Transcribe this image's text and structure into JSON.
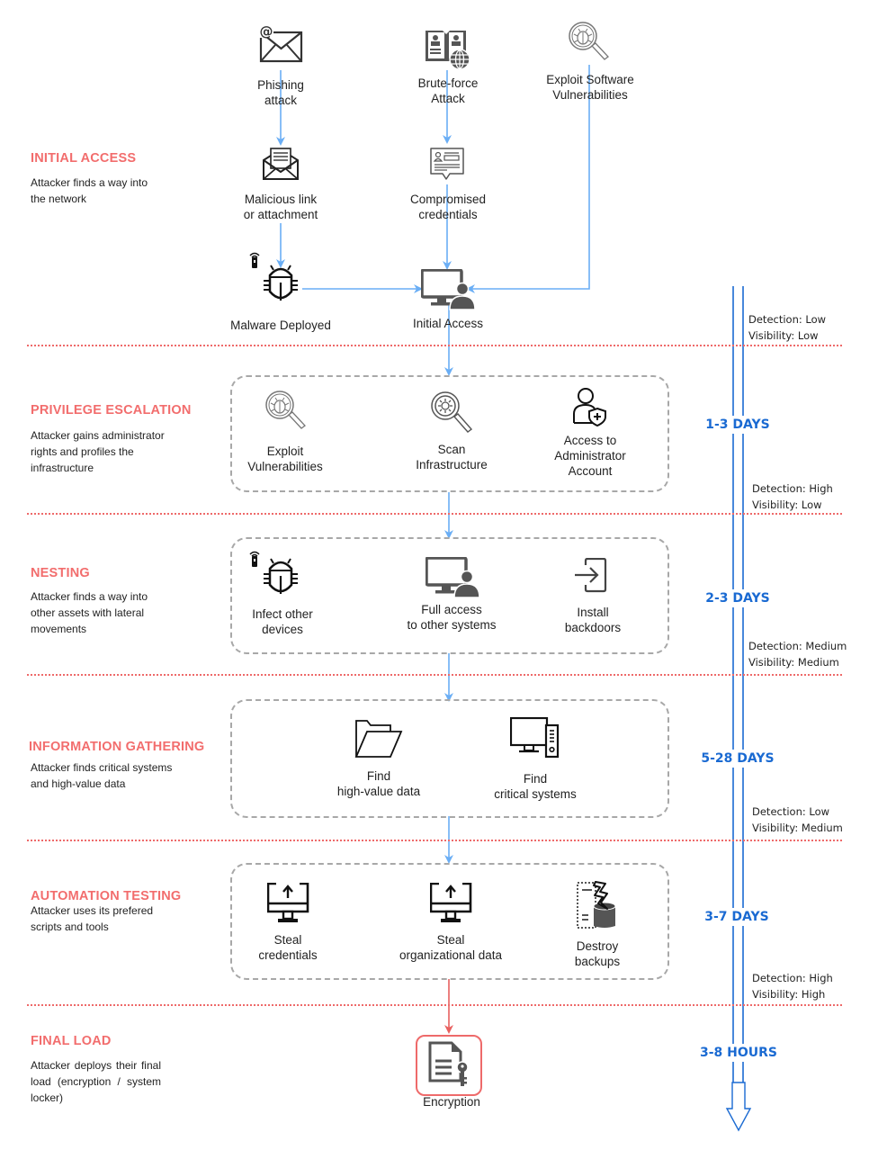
{
  "phases": [
    {
      "title": "INITIAL ACCESS",
      "description": "Attacker finds a way into the network",
      "nodes": [
        {
          "label": "Phishing attack",
          "icon": "email-at-icon"
        },
        {
          "label": "Brute-force Attack",
          "icon": "address-book-globe-icon"
        },
        {
          "label": "Exploit Software Vulnerabilities",
          "icon": "bug-magnifier-icon"
        },
        {
          "label": "Malicious link or attachment",
          "icon": "open-envelope-letter-icon"
        },
        {
          "label": "Compromised credentials",
          "icon": "id-card-bubble-icon"
        },
        {
          "label": "Malware Deployed",
          "icon": "bug-remote-icon"
        },
        {
          "label": "Initial Access",
          "icon": "computer-user-icon"
        }
      ],
      "duration": "",
      "detection": "Low",
      "visibility": "Low"
    },
    {
      "title": "PRIVILEGE ESCALATION",
      "description": "Attacker gains administrator rights and profiles the infrastructure",
      "nodes": [
        {
          "label": "Exploit Vulnerabilities",
          "icon": "bug-magnifier-icon"
        },
        {
          "label": "Scan Infrastructure",
          "icon": "virus-magnifier-icon"
        },
        {
          "label": "Access to Administrator Account",
          "icon": "user-shield-icon"
        }
      ],
      "duration": "1-3 DAYS",
      "detection": "High",
      "visibility": "Low"
    },
    {
      "title": "NESTING",
      "description": "Attacker finds a way into other assets with lateral movements",
      "nodes": [
        {
          "label": "Infect other devices",
          "icon": "bug-remote-icon"
        },
        {
          "label": "Full access to other systems",
          "icon": "computer-user-icon"
        },
        {
          "label": "Install backdoors",
          "icon": "sign-in-icon"
        }
      ],
      "duration": "2-3 DAYS",
      "detection": "Medium",
      "visibility": "Medium"
    },
    {
      "title": "INFORMATION GATHERING",
      "description": "Attacker finds critical systems and high-value data",
      "nodes": [
        {
          "label": "Find high-value data",
          "icon": "folder-open-icon"
        },
        {
          "label": "Find critical systems",
          "icon": "desktop-tower-icon"
        }
      ],
      "duration": "5-28 DAYS",
      "detection": "Low",
      "visibility": "Medium"
    },
    {
      "title": "AUTOMATION TESTING",
      "description": "Attacker uses its prefered scripts and tools",
      "nodes": [
        {
          "label": "Steal credentials",
          "icon": "monitor-upload-icon"
        },
        {
          "label": "Steal organizational data",
          "icon": "monitor-upload-icon"
        },
        {
          "label": "Destroy backups",
          "icon": "database-lightning-icon"
        }
      ],
      "duration": "3-7 DAYS",
      "detection": "High",
      "visibility": "High"
    },
    {
      "title": "FINAL LOAD",
      "description": "Attacker deploys their final load (encryption / system locker)",
      "nodes": [
        {
          "label": "Encryption",
          "icon": "document-key-icon"
        }
      ],
      "duration": "3-8 HOURS"
    }
  ],
  "labels": {
    "detection_prefix": "Detection: ",
    "visibility_prefix": "Visibility: "
  },
  "text": {
    "p0_node0_l1": "Phishing",
    "p0_node0_l2": "attack",
    "p0_node1_l1": "Brute-force",
    "p0_node1_l2": "Attack",
    "p0_node2_l1": "Exploit Software",
    "p0_node2_l2": "Vulnerabilities",
    "p0_node3_l1": "Malicious link",
    "p0_node3_l2": "or attachment",
    "p0_node4_l1": "Compromised",
    "p0_node4_l2": "credentials",
    "p0_node5_l1": "Malware Deployed",
    "p0_node6_l1": "Initial Access",
    "p0_desc_l1": "Attacker finds a way into",
    "p0_desc_l2": "the network",
    "p1_node0_l1": "Exploit",
    "p1_node0_l2": "Vulnerabilities",
    "p1_node1_l1": "Scan",
    "p1_node1_l2": "Infrastructure",
    "p1_node2_l1": "Access to",
    "p1_node2_l2": "Administrator",
    "p1_node2_l3": "Account",
    "p1_desc_l1": "Attacker gains administrator",
    "p1_desc_l2": "rights and profiles the",
    "p1_desc_l3": "infrastructure",
    "p2_node0_l1": "Infect other",
    "p2_node0_l2": "devices",
    "p2_node1_l1": "Full access",
    "p2_node1_l2": "to other systems",
    "p2_node2_l1": "Install",
    "p2_node2_l2": "backdoors",
    "p2_desc_l1": "Attacker finds a way into",
    "p2_desc_l2": "other assets with lateral",
    "p2_desc_l3": "movements",
    "p3_node0_l1": "Find",
    "p3_node0_l2": "high-value data",
    "p3_node1_l1": "Find",
    "p3_node1_l2": "critical systems",
    "p3_desc_l1": "Attacker finds critical systems",
    "p3_desc_l2": "and high-value data",
    "p4_node0_l1": "Steal",
    "p4_node0_l2": "credentials",
    "p4_node1_l1": "Steal",
    "p4_node1_l2": "organizational data",
    "p4_node2_l1": "Destroy",
    "p4_node2_l2": "backups",
    "p4_desc_l1": "Attacker uses its prefered",
    "p4_desc_l2": "scripts and tools",
    "p5_desc": "Attacker deploys their final load (encryption / system locker)"
  },
  "colors": {
    "phase_title": "#f26d6d",
    "separator": "#ee6a6a",
    "flow_arrow": "#6aaef5",
    "final_arrow": "#e8605f",
    "timeline": "#1a6ad2",
    "box_border": "#a8a8a8",
    "icon": "#333333"
  }
}
